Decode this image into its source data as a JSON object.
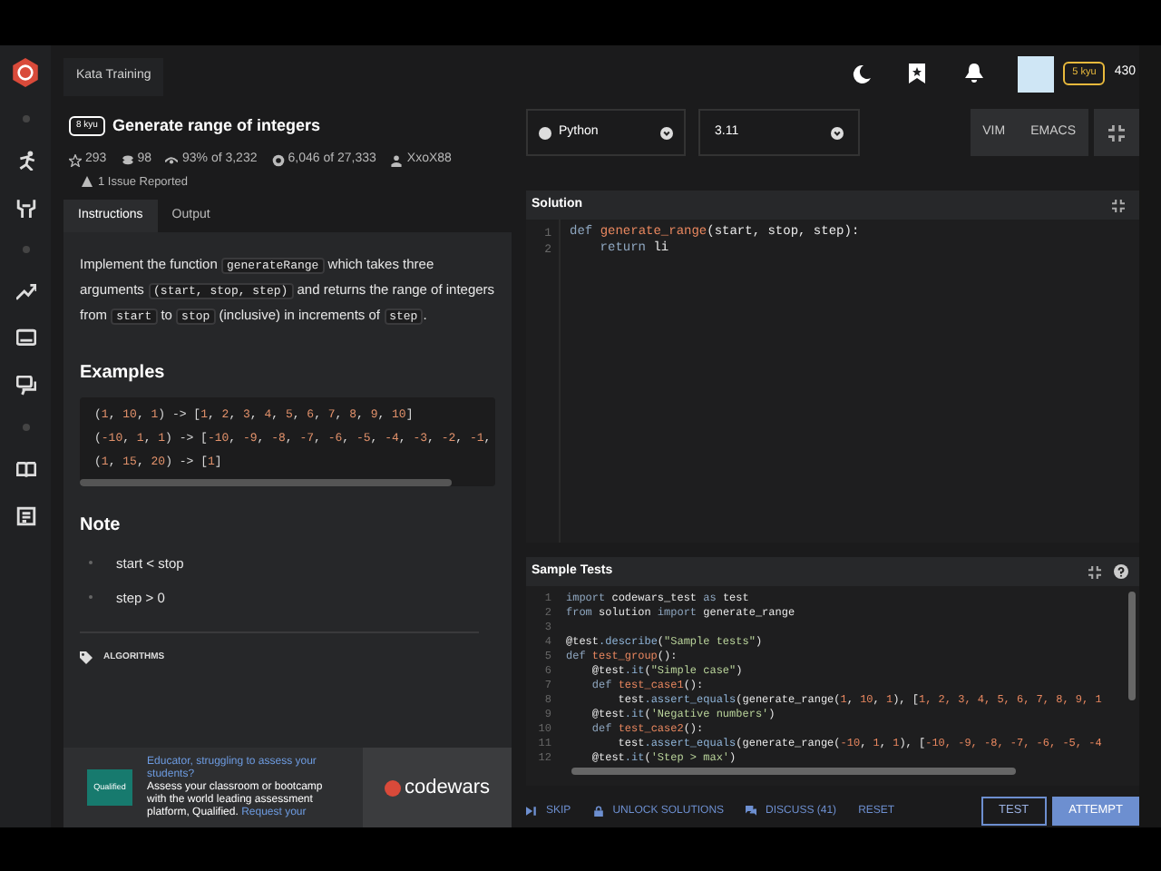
{
  "breadcrumb": "Kata Training",
  "kata": {
    "rank": "8 kyu",
    "title": "Generate range of integers",
    "issue": "1 Issue Reported",
    "stats": [
      {
        "kind": "star",
        "text": "293"
      },
      {
        "kind": "stack",
        "text": "98"
      },
      {
        "kind": "eye",
        "text": "93% of 3,232"
      },
      {
        "kind": "target",
        "text": "6,046 of 27,333"
      },
      {
        "kind": "person",
        "text": "XxoX88"
      }
    ]
  },
  "tabs": [
    {
      "label": "Instructions",
      "selected": true
    },
    {
      "label": "Output",
      "selected": false
    }
  ],
  "description": [
    {
      "kind": "text",
      "t": "Implement the function "
    },
    {
      "kind": "code",
      "t": "generateRange"
    },
    {
      "kind": "text",
      "t": " which takes three arguments "
    },
    {
      "kind": "code",
      "t": "(start, stop, step)"
    },
    {
      "kind": "text",
      "t": " and returns the range of integers from "
    },
    {
      "kind": "code",
      "t": "start"
    },
    {
      "kind": "text",
      "t": " to "
    },
    {
      "kind": "code",
      "t": "stop"
    },
    {
      "kind": "text",
      "t": " (inclusive) in increments of "
    },
    {
      "kind": "code",
      "t": "step"
    },
    {
      "kind": "text",
      "t": "."
    }
  ],
  "examples_heading": "Examples",
  "examples": [
    "(1, 10, 1) -> [1, 2, 3, 4, 5, 6, 7, 8, 9, 10]",
    "(-10, 1, 1) -> [-10, -9, -8, -7, -6, -5, -4, -3, -2, -1,",
    "(1, 15, 20) -> [1]"
  ],
  "note_heading": "Note",
  "notes": [
    "start < stop",
    "step > 0"
  ],
  "tags": [
    "ALGORITHMS"
  ],
  "ad": {
    "badge": "Qualified",
    "title": "Educator, struggling to assess your students?",
    "body": "Assess your classroom or bootcamp with the world leading assessment platform, Qualified.",
    "link": "Request your",
    "brand": "codewars"
  },
  "header": {
    "rank": "5 kyu",
    "honor": "430"
  },
  "language": "Python",
  "version": "3.11",
  "modes": [
    "VIM",
    "EMACS"
  ],
  "solution": {
    "title": "Solution",
    "lines": [
      {
        "n": "1",
        "s": [
          {
            "kind": "kw",
            "t": "def "
          },
          {
            "kind": "fn",
            "t": "generate_range"
          },
          {
            "kind": "plain",
            "t": "(start, stop, step):"
          }
        ]
      },
      {
        "n": "2",
        "s": [
          {
            "kind": "kw",
            "t": "    return "
          },
          {
            "kind": "plain",
            "t": "li"
          }
        ]
      }
    ]
  },
  "tests": {
    "title": "Sample Tests",
    "lines": [
      {
        "n": "1",
        "s": [
          {
            "kind": "kw",
            "t": "import "
          },
          {
            "kind": "plain",
            "t": "codewars_test "
          },
          {
            "kind": "kw",
            "t": "as "
          },
          {
            "kind": "plain",
            "t": "test"
          }
        ]
      },
      {
        "n": "2",
        "s": [
          {
            "kind": "kw",
            "t": "from "
          },
          {
            "kind": "plain",
            "t": "solution "
          },
          {
            "kind": "kw",
            "t": "import "
          },
          {
            "kind": "plain",
            "t": "generate_range"
          }
        ]
      },
      {
        "n": "3"
      },
      {
        "n": "4",
        "s": [
          {
            "kind": "plain",
            "t": "@test"
          },
          {
            "kind": "method",
            "t": ".describe"
          },
          {
            "kind": "plain",
            "t": "("
          },
          {
            "kind": "str",
            "t": "\"Sample tests\""
          },
          {
            "kind": "plain",
            "t": ")"
          }
        ]
      },
      {
        "n": "5",
        "s": [
          {
            "kind": "kw",
            "t": "def "
          },
          {
            "kind": "fn",
            "t": "test_group"
          },
          {
            "kind": "plain",
            "t": "():"
          }
        ]
      },
      {
        "n": "6",
        "s": [
          {
            "kind": "plain",
            "t": "    @test"
          },
          {
            "kind": "method",
            "t": ".it"
          },
          {
            "kind": "plain",
            "t": "("
          },
          {
            "kind": "str",
            "t": "\"Simple case\""
          },
          {
            "kind": "plain",
            "t": ")"
          }
        ]
      },
      {
        "n": "7",
        "s": [
          {
            "kind": "kw",
            "t": "    def "
          },
          {
            "kind": "fn",
            "t": "test_case1"
          },
          {
            "kind": "plain",
            "t": "():"
          }
        ]
      },
      {
        "n": "8",
        "s": [
          {
            "kind": "plain",
            "t": "        test"
          },
          {
            "kind": "method",
            "t": ".assert_equals"
          },
          {
            "kind": "plain",
            "t": "(generate_range("
          },
          {
            "kind": "num",
            "t": "1"
          },
          {
            "kind": "plain",
            "t": ", "
          },
          {
            "kind": "num",
            "t": "10"
          },
          {
            "kind": "plain",
            "t": ", "
          },
          {
            "kind": "num",
            "t": "1"
          },
          {
            "kind": "plain",
            "t": "), ["
          },
          {
            "kind": "num",
            "t": "1, 2, 3, 4, 5, 6, 7, 8, 9, 1"
          }
        ]
      },
      {
        "n": "9",
        "s": [
          {
            "kind": "plain",
            "t": "    @test"
          },
          {
            "kind": "method",
            "t": ".it"
          },
          {
            "kind": "plain",
            "t": "("
          },
          {
            "kind": "str",
            "t": "'Negative numbers'"
          },
          {
            "kind": "plain",
            "t": ")"
          }
        ]
      },
      {
        "n": "10",
        "s": [
          {
            "kind": "kw",
            "t": "    def "
          },
          {
            "kind": "fn",
            "t": "test_case2"
          },
          {
            "kind": "plain",
            "t": "():"
          }
        ]
      },
      {
        "n": "11",
        "s": [
          {
            "kind": "plain",
            "t": "        test"
          },
          {
            "kind": "method",
            "t": ".assert_equals"
          },
          {
            "kind": "plain",
            "t": "(generate_range("
          },
          {
            "kind": "num",
            "t": "-10"
          },
          {
            "kind": "plain",
            "t": ", "
          },
          {
            "kind": "num",
            "t": "1"
          },
          {
            "kind": "plain",
            "t": ", "
          },
          {
            "kind": "num",
            "t": "1"
          },
          {
            "kind": "plain",
            "t": "), ["
          },
          {
            "kind": "num",
            "t": "-10, -9, -8, -7, -6, -5, -4"
          }
        ]
      },
      {
        "n": "12",
        "s": [
          {
            "kind": "plain",
            "t": "    @test"
          },
          {
            "kind": "method",
            "t": ".it"
          },
          {
            "kind": "plain",
            "t": "("
          },
          {
            "kind": "str",
            "t": "'Step > max'"
          },
          {
            "kind": "plain",
            "t": ")"
          }
        ]
      }
    ]
  },
  "actions": [
    {
      "kind": "skip",
      "label": "SKIP"
    },
    {
      "kind": "lock",
      "label": "UNLOCK SOLUTIONS"
    },
    {
      "kind": "chat",
      "label": "DISCUSS (41)"
    },
    {
      "kind": "none",
      "label": "RESET"
    }
  ],
  "buttons": [
    {
      "kind": "outline",
      "label": "TEST"
    },
    {
      "kind": "primary",
      "label": "ATTEMPT"
    }
  ]
}
